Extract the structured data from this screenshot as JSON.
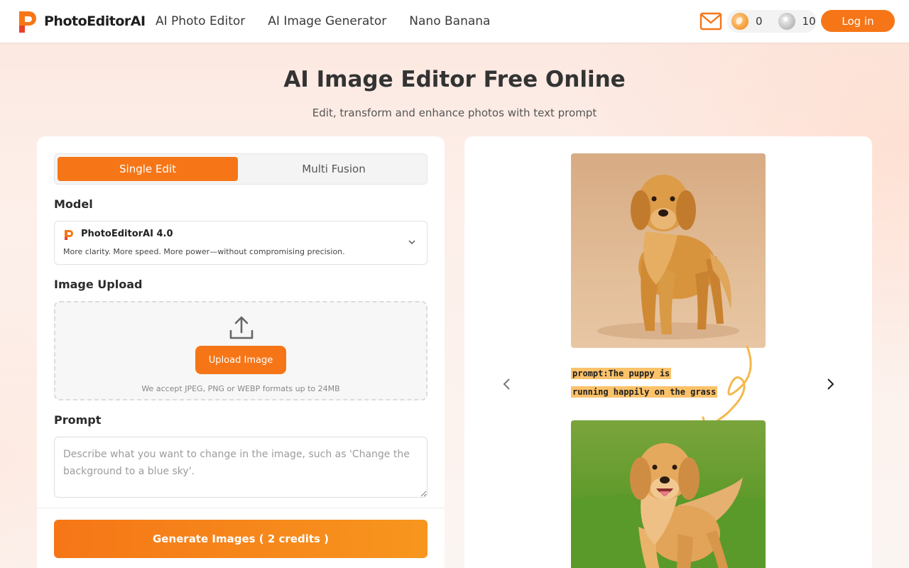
{
  "header": {
    "brand": "PhotoEditorAI",
    "nav": [
      "AI Photo Editor",
      "AI Image Generator",
      "Nano Banana"
    ],
    "credits_gold": "0",
    "credits_silver": "10",
    "login_label": "Log in"
  },
  "hero": {
    "title": "AI Image Editor Free Online",
    "subtitle": "Edit, transform and enhance photos with text prompt"
  },
  "editor": {
    "tabs": [
      "Single Edit",
      "Multi Fusion"
    ],
    "model_label": "Model",
    "model_name": "PhotoEditorAI 4.0",
    "model_desc": "More clarity. More speed. More power—without compromising precision.",
    "upload_label": "Image Upload",
    "upload_button": "Upload Image",
    "upload_note": "We accept JPEG, PNG or WEBP formats up to 24MB",
    "prompt_label": "Prompt",
    "prompt_placeholder": "Describe what you want to change in the image, such as 'Change the background to a blue sky'.",
    "generate_label": "Generate Images ( 2 credits )"
  },
  "showcase": {
    "prompt_line1": "prompt:The puppy is",
    "prompt_line2": "running happily on the grass"
  },
  "colors": {
    "accent": "#f67617",
    "accent_light": "#f7961e",
    "highlight": "#fbc26a"
  }
}
